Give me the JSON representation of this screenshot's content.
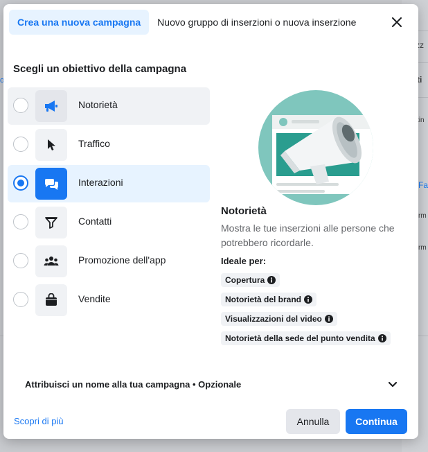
{
  "tabs": [
    {
      "label": "Crea una nuova campagna",
      "active": true
    },
    {
      "label": "Nuovo gruppo di inserzioni o nuova inserzione",
      "active": false
    }
  ],
  "section_title": "Scegli un obiettivo della campagna",
  "objectives": [
    {
      "label": "Notorietà",
      "icon": "megaphone-icon",
      "selected": false,
      "hover": true
    },
    {
      "label": "Traffico",
      "icon": "cursor-icon",
      "selected": false
    },
    {
      "label": "Interazioni",
      "icon": "chat-bubbles-icon",
      "selected": true
    },
    {
      "label": "Contatti",
      "icon": "filter-icon",
      "selected": false
    },
    {
      "label": "Promozione dell'app",
      "icon": "people-icon",
      "selected": false
    },
    {
      "label": "Vendite",
      "icon": "shopping-bag-icon",
      "selected": false
    }
  ],
  "detail": {
    "title": "Notorietà",
    "description": "Mostra le tue inserzioni alle persone che potrebbero ricordarle.",
    "ideal_label": "Ideale per:",
    "tags": [
      "Copertura",
      "Notorietà del brand",
      "Visualizzazioni del video",
      "Notorietà della sede del punto vendita"
    ]
  },
  "campaign_name_toggle": "Attribuisci un nome alla tua campagna • Opzionale",
  "footer": {
    "learn_more": "Scopri di più",
    "cancel": "Annulla",
    "continue": "Continua"
  },
  "background": {
    "snippets": [
      "zz",
      "ti",
      "tin",
      "Fa",
      "rm",
      "rm"
    ]
  },
  "colors": {
    "accent": "#1877f2",
    "selected_bg": "#e7f3ff",
    "illustration_teal": "#2a9d8f",
    "illustration_bg": "#7fc6bd"
  }
}
